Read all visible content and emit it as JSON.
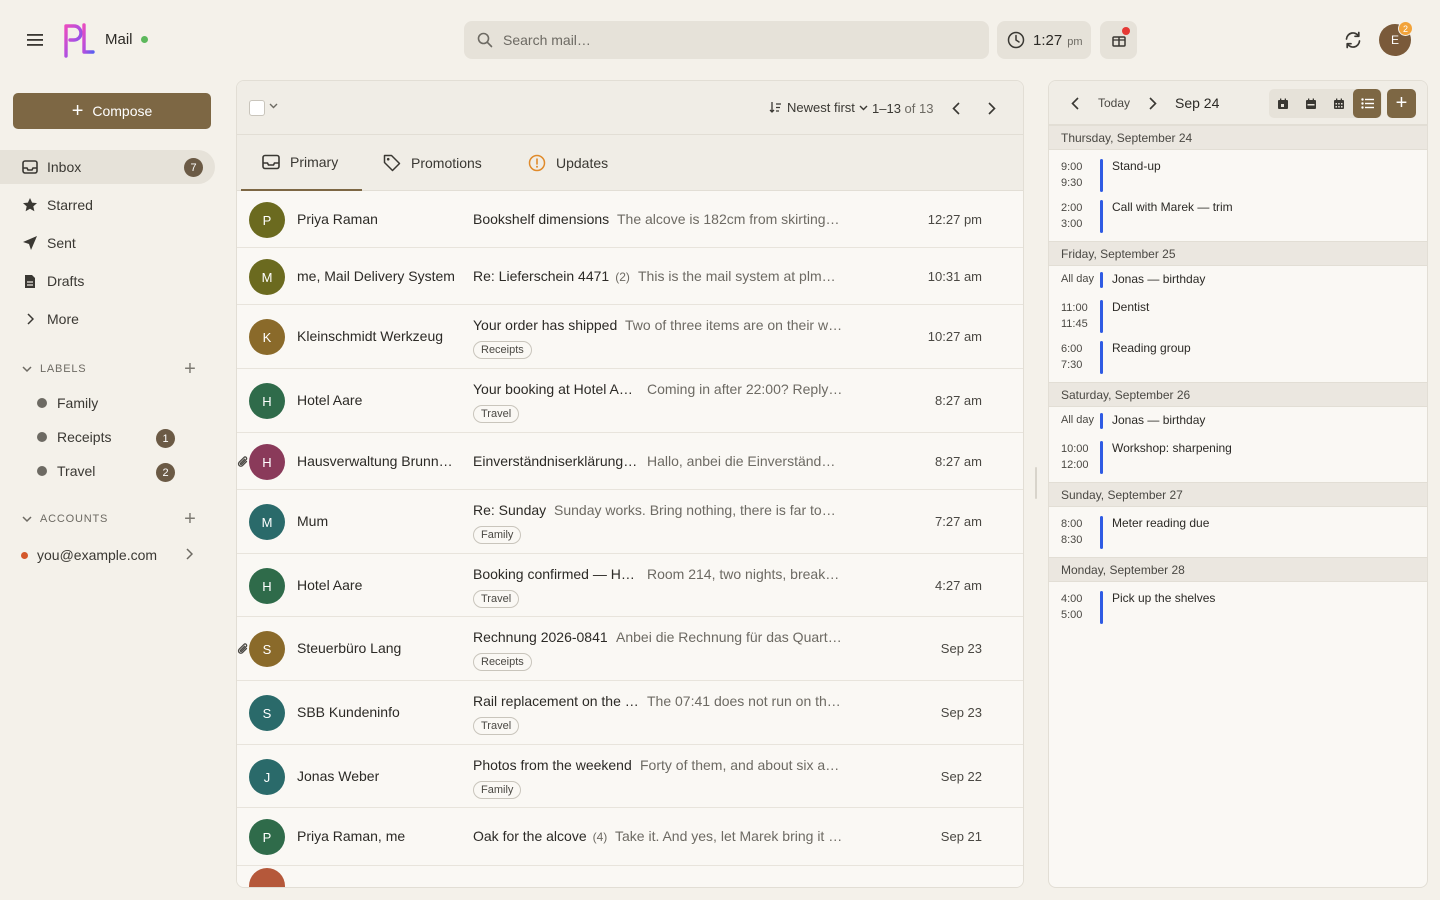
{
  "app": {
    "name": "Mail",
    "search_placeholder": "Search mail…",
    "clock_time": "1:27",
    "clock_ampm": "pm",
    "avatar_initial": "E",
    "avatar_badge": "2",
    "colors": {
      "accent": "#7d6744",
      "status_online": "#5cb85c",
      "event_bar": "#2f5be3"
    }
  },
  "sidebar": {
    "compose_label": "Compose",
    "nav": [
      {
        "label": "Inbox",
        "count": "7",
        "icon": "inbox-icon"
      },
      {
        "label": "Starred",
        "icon": "star-icon"
      },
      {
        "label": "Sent",
        "icon": "send-icon"
      },
      {
        "label": "Drafts",
        "icon": "draft-icon"
      },
      {
        "label": "More",
        "icon": "chevron-right-icon"
      }
    ],
    "labels_title": "LABELS",
    "labels": [
      {
        "name": "Family"
      },
      {
        "name": "Receipts",
        "count": "1"
      },
      {
        "name": "Travel",
        "count": "2"
      }
    ],
    "accounts_title": "ACCOUNTS",
    "account": "you@example.com"
  },
  "mail": {
    "sort_label": "Newest first",
    "range_start": "1–13",
    "range_of": "of 13",
    "tabs": [
      {
        "label": "Primary"
      },
      {
        "label": "Promotions"
      },
      {
        "label": "Updates"
      }
    ],
    "rows": [
      {
        "initial": "P",
        "color": "#6b6a1f",
        "sender": "Priya Raman",
        "subject": "Bookshelf dimensions",
        "count": "",
        "snippet": "The alcove is 182cm from skirting …",
        "time": "12:27 pm",
        "tag": "",
        "clip": false
      },
      {
        "initial": "M",
        "color": "#6b6a1f",
        "sender": "me, Mail Delivery System",
        "subject": "Re: Lieferschein 4471",
        "count": "(2)",
        "snippet": "This is the mail system at plm…",
        "time": "10:31 am",
        "tag": "",
        "clip": false
      },
      {
        "initial": "K",
        "color": "#8a6a2a",
        "sender": "Kleinschmidt Werkzeug",
        "subject": "Your order has shipped",
        "count": "",
        "snippet": "Two of three items are on their w…",
        "time": "10:27 am",
        "tag": "Receipts",
        "clip": false
      },
      {
        "initial": "H",
        "color": "#2f6b4a",
        "sender": "Hotel Aare",
        "subject": "Your booking at Hotel Aa…",
        "count": "",
        "snippet": "Coming in after 22:00? Reply…",
        "time": "8:27 am",
        "tag": "Travel",
        "clip": false
      },
      {
        "initial": "H",
        "color": "#8a3a5a",
        "sender": "Hausverwaltung Brunne…",
        "subject": "Einverständniserklärung …",
        "count": "",
        "snippet": "Hallo, anbei die Einverständn…",
        "time": "8:27 am",
        "tag": "",
        "clip": true
      },
      {
        "initial": "M",
        "color": "#2a6a6a",
        "sender": "Mum",
        "subject": "Re: Sunday",
        "count": "",
        "snippet": "Sunday works. Bring nothing, there is far too …",
        "time": "7:27 am",
        "tag": "Family",
        "clip": false
      },
      {
        "initial": "H",
        "color": "#2f6b4a",
        "sender": "Hotel Aare",
        "subject": "Booking confirmed — Ho…",
        "count": "",
        "snippet": "Room 214, two nights, break…",
        "time": "4:27 am",
        "tag": "Travel",
        "clip": false
      },
      {
        "initial": "S",
        "color": "#8a6a2a",
        "sender": "Steuerbüro Lang",
        "subject": "Rechnung 2026-0841",
        "count": "",
        "snippet": "Anbei die Rechnung für das Quart…",
        "time": "Sep 23",
        "tag": "Receipts",
        "clip": true
      },
      {
        "initial": "S",
        "color": "#2a6a6a",
        "sender": "SBB Kundeninfo",
        "subject": "Rail replacement on the …",
        "count": "",
        "snippet": "The 07:41 does not run on th…",
        "time": "Sep 23",
        "tag": "Travel",
        "clip": false
      },
      {
        "initial": "J",
        "color": "#2a6a6a",
        "sender": "Jonas Weber",
        "subject": "Photos from the weekend",
        "count": "",
        "snippet": "Forty of them, and about six ar…",
        "time": "Sep 22",
        "tag": "Family",
        "clip": false
      },
      {
        "initial": "P",
        "color": "#2f6b4a",
        "sender": "Priya Raman, me",
        "subject": "Oak for the alcove",
        "count": "(4)",
        "snippet": "Take it. And yes, let Marek bring it …",
        "time": "Sep 21",
        "tag": "",
        "clip": false
      },
      {
        "initial": "",
        "color": "#b5583a",
        "sender": "",
        "subject": "",
        "count": "",
        "snippet": "",
        "time": "",
        "tag": "",
        "clip": false
      }
    ]
  },
  "calendar": {
    "today_label": "Today",
    "current_date": "Sep 24",
    "days": [
      {
        "label": "Thursday, September 24",
        "events": [
          {
            "start": "9:00",
            "end": "9:30",
            "title": "Stand-up"
          },
          {
            "start": "2:00",
            "end": "3:00",
            "title": "Call with Marek — trim"
          }
        ]
      },
      {
        "label": "Friday, September 25",
        "events": [
          {
            "start": "All day",
            "end": "",
            "title": "Jonas — birthday"
          },
          {
            "start": "11:00",
            "end": "11:45",
            "title": "Dentist"
          },
          {
            "start": "6:00",
            "end": "7:30",
            "title": "Reading group"
          }
        ]
      },
      {
        "label": "Saturday, September 26",
        "events": [
          {
            "start": "All day",
            "end": "",
            "title": "Jonas — birthday"
          },
          {
            "start": "10:00",
            "end": "12:00",
            "title": "Workshop: sharpening"
          }
        ]
      },
      {
        "label": "Sunday, September 27",
        "events": [
          {
            "start": "8:00",
            "end": "8:30",
            "title": "Meter reading due"
          }
        ]
      },
      {
        "label": "Monday, September 28",
        "events": [
          {
            "start": "4:00",
            "end": "5:00",
            "title": "Pick up the shelves"
          }
        ]
      }
    ]
  }
}
